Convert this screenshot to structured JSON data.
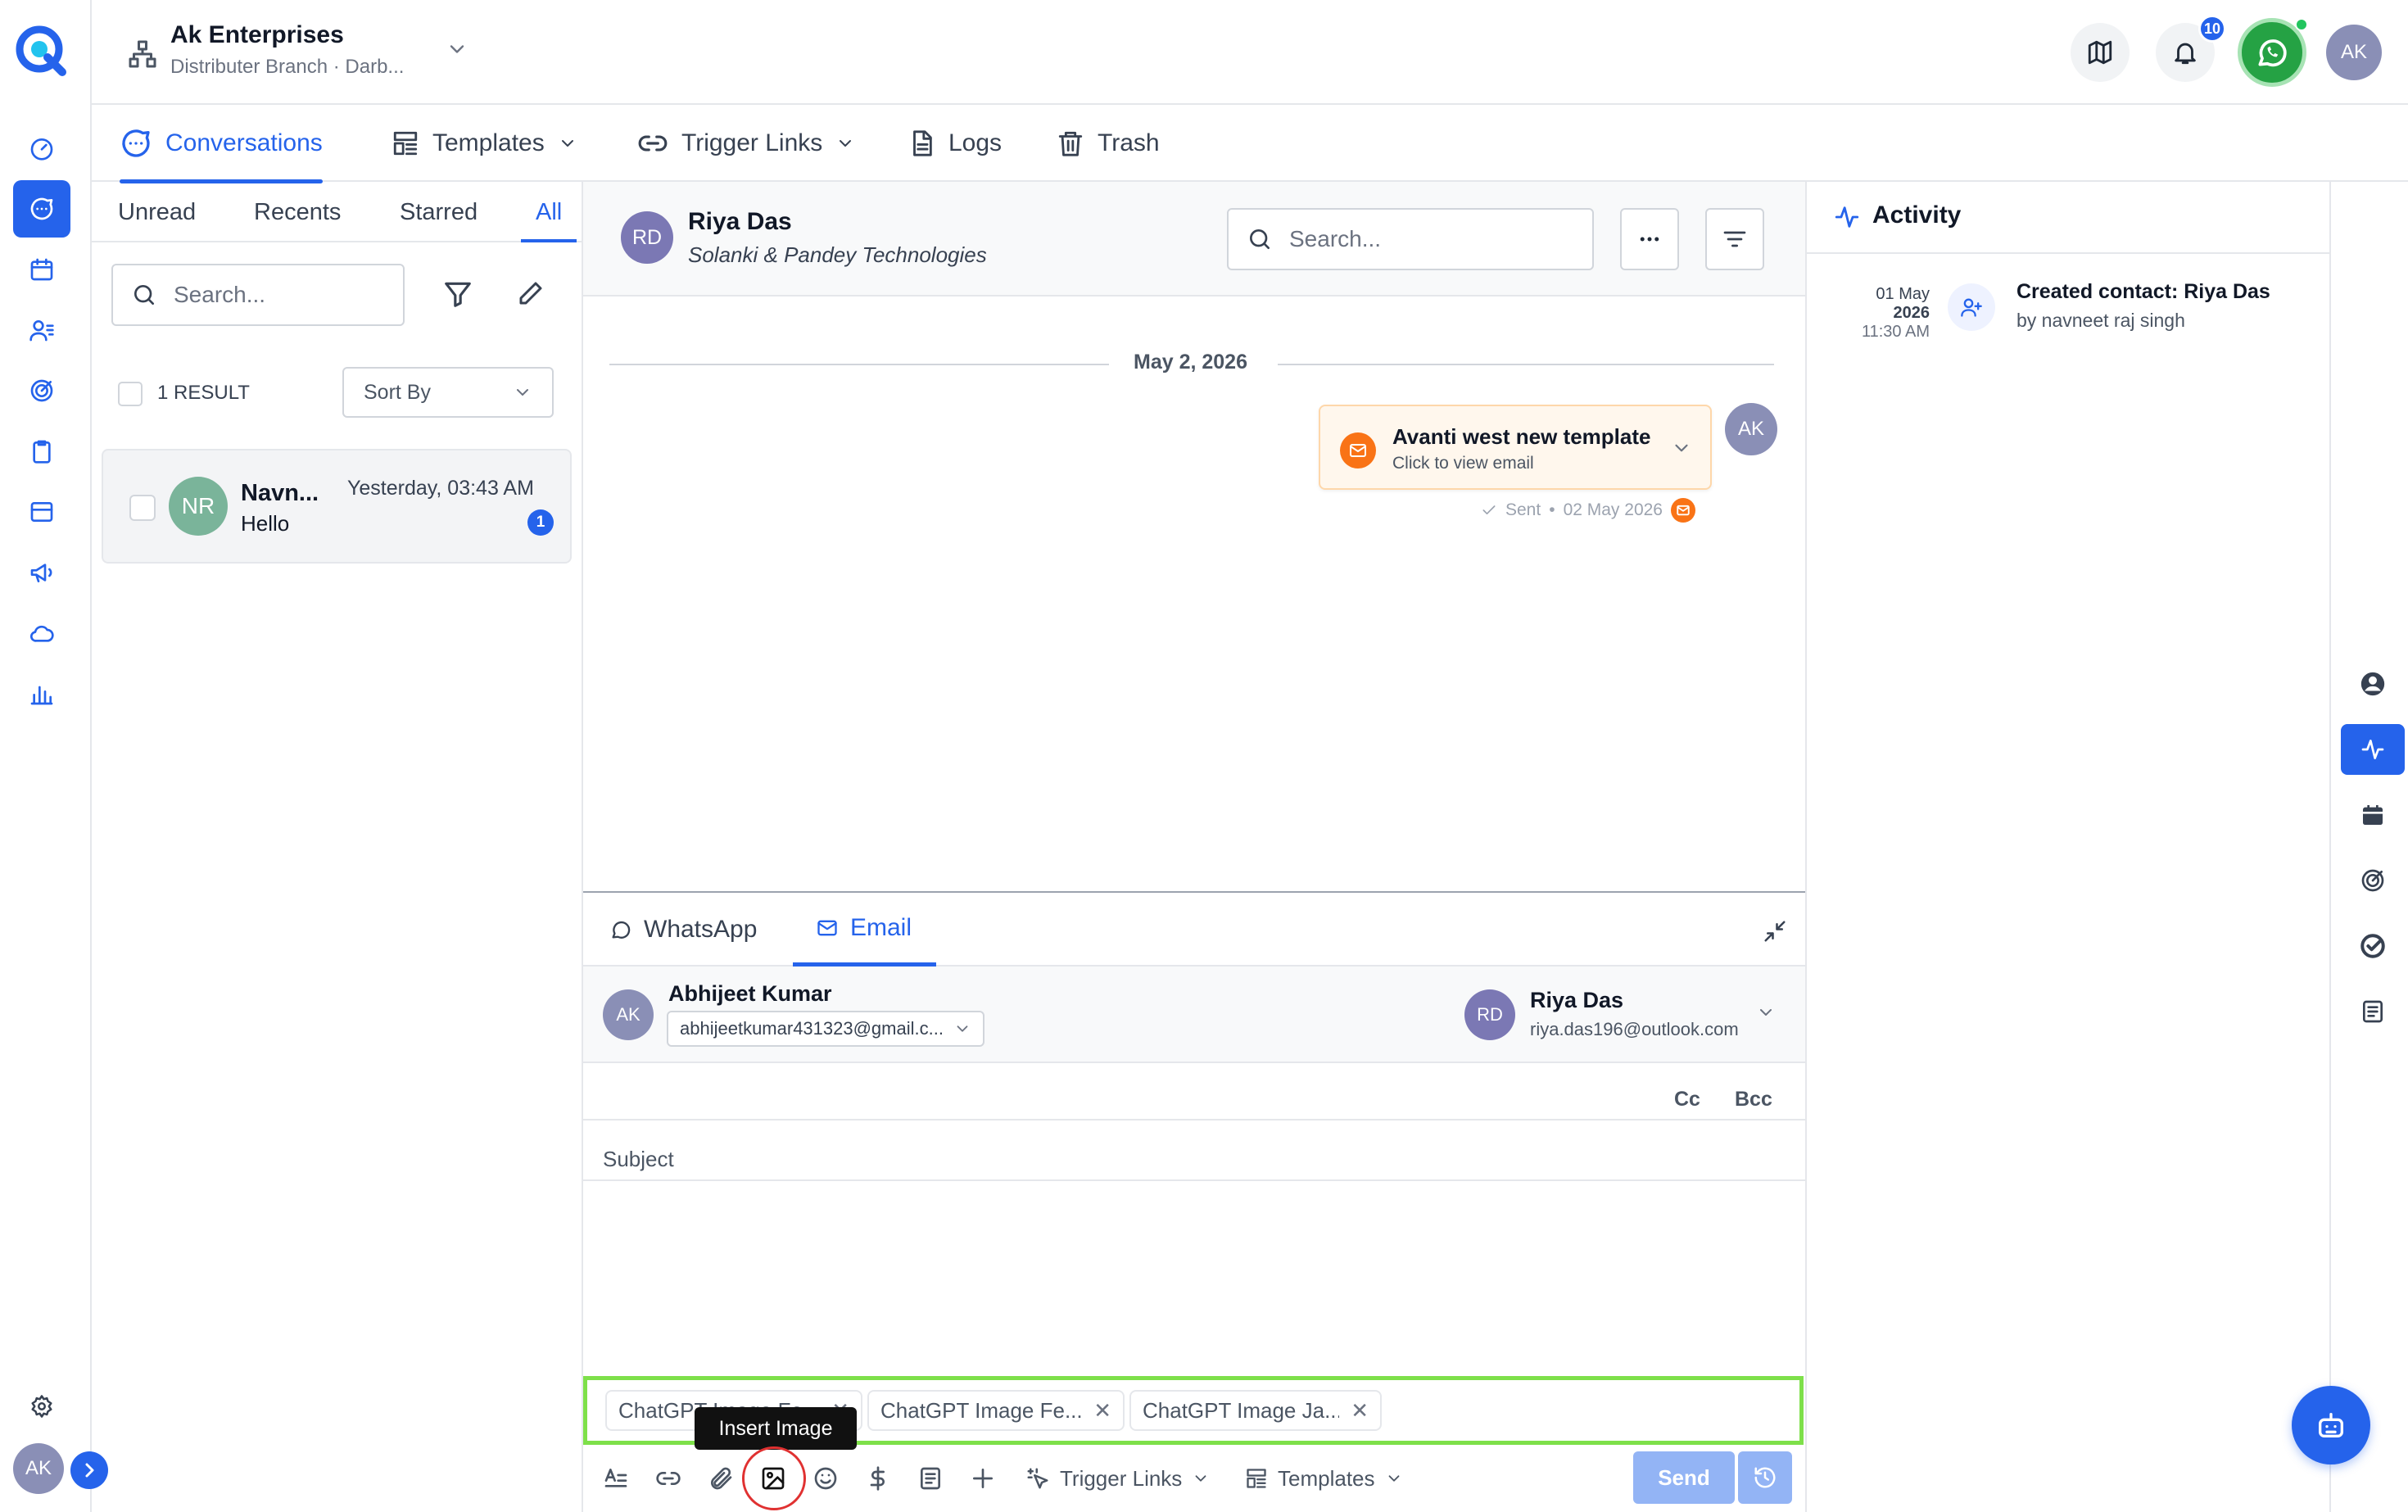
{
  "header": {
    "org_name": "Ak Enterprises",
    "branch": "Distributer Branch · Darb...",
    "notification_count": "10",
    "user_initials": "AK"
  },
  "nav": {
    "tabs": [
      {
        "label": "Conversations",
        "icon": "chat-bubble-icon",
        "active": true
      },
      {
        "label": "Templates",
        "icon": "template-icon"
      },
      {
        "label": "Trigger Links",
        "icon": "link-icon"
      },
      {
        "label": "Logs",
        "icon": "document-icon"
      },
      {
        "label": "Trash",
        "icon": "trash-icon"
      }
    ]
  },
  "list": {
    "filters": [
      "Unread",
      "Recents",
      "Starred",
      "All"
    ],
    "active_filter": "All",
    "search_placeholder": "Search...",
    "result_count": "1 RESULT",
    "sort_label": "Sort By",
    "items": [
      {
        "initials": "NR",
        "name": "Navn...",
        "preview": "Hello",
        "time": "Yesterday, 03:43 AM",
        "unread": "1"
      }
    ]
  },
  "chat": {
    "contact_initials": "RD",
    "contact_name": "Riya Das",
    "contact_company": "Solanki & Pandey Technologies",
    "search_placeholder": "Search...",
    "date_divider": "May 2, 2026",
    "message": {
      "title": "Avanti west new template",
      "subtitle": "Click to view email",
      "status": "Sent",
      "date": "02 May 2026",
      "sender_initials": "AK"
    }
  },
  "composer": {
    "tabs": [
      "WhatsApp",
      "Email"
    ],
    "active_tab": "Email",
    "from_initials": "AK",
    "from_name": "Abhijeet Kumar",
    "from_email": "abhijeetkumar431323@gmail.c...",
    "to_initials": "RD",
    "to_name": "Riya Das",
    "to_email": "riya.das196@outlook.com",
    "cc": "Cc",
    "bcc": "Bcc",
    "subject_placeholder": "Subject",
    "attachments": [
      "ChatGPT Image Fe...",
      "ChatGPT Image Fe...",
      "ChatGPT Image Ja..."
    ],
    "tooltip": "Insert Image",
    "trigger_links": "Trigger Links",
    "templates": "Templates",
    "send": "Send"
  },
  "activity": {
    "title": "Activity",
    "entries": [
      {
        "day": "01 May",
        "year": "2026",
        "time": "11:30 AM",
        "text": "Created contact: Riya Das",
        "by": "by navneet raj singh"
      }
    ]
  },
  "colors": {
    "accent": "#2563eb",
    "whatsapp": "#25a244",
    "email_orange": "#f97316",
    "highlight_green": "#7ee04a",
    "annotation_red": "#e03131"
  }
}
